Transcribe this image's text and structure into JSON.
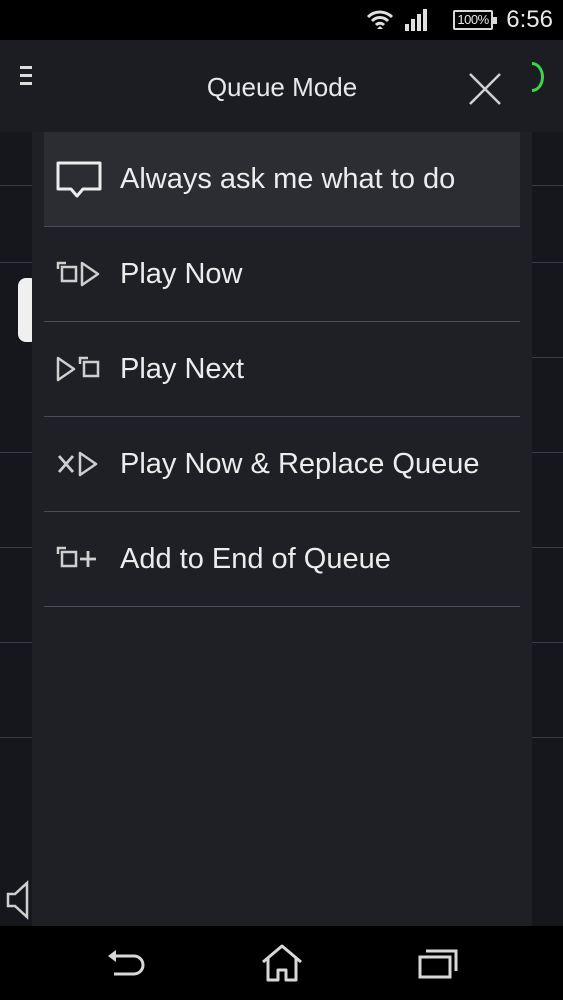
{
  "status_bar": {
    "battery_text": "100%",
    "time": "6:56",
    "icons": [
      "wifi-icon",
      "signal-icon",
      "battery-icon"
    ]
  },
  "dialog": {
    "title": "Queue Mode",
    "close_icon": "close-icon",
    "options": [
      {
        "label": "Always ask me what to do",
        "icon": "speech-bubble-icon",
        "selected": true
      },
      {
        "label": "Play Now",
        "icon": "play-now-icon",
        "selected": false
      },
      {
        "label": "Play Next",
        "icon": "play-next-icon",
        "selected": false
      },
      {
        "label": "Play Now & Replace Queue",
        "icon": "replace-queue-icon",
        "selected": false
      },
      {
        "label": "Add to End of Queue",
        "icon": "add-to-queue-icon",
        "selected": false
      }
    ]
  },
  "nav_bar": {
    "buttons": [
      "back-icon",
      "home-icon",
      "recent-apps-icon"
    ]
  },
  "colors": {
    "dialog_bg": "#1e2025",
    "selected_bg": "#2b2d33",
    "divider": "#4a4d54",
    "accent_green": "#3bd44a"
  }
}
